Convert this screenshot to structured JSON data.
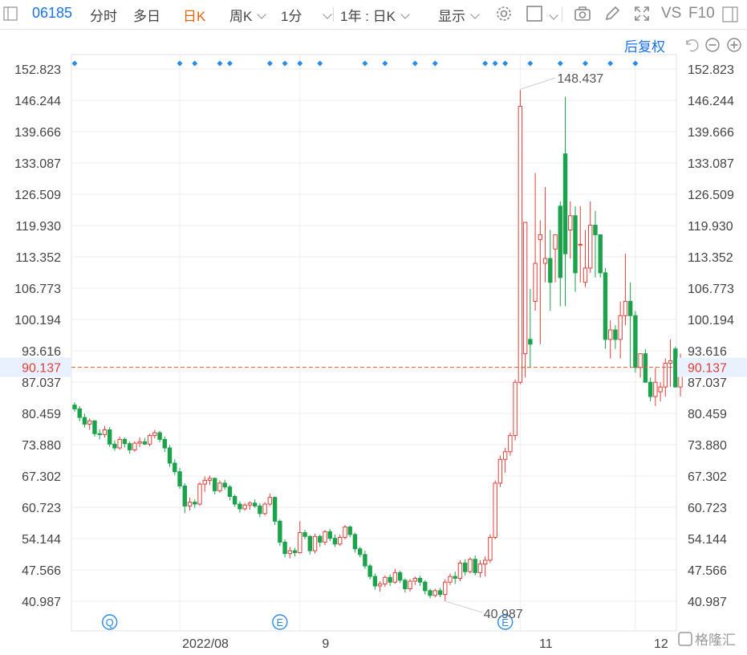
{
  "toolbar": {
    "code": "06185",
    "tabs": [
      "分时",
      "多日",
      "日K",
      "周K",
      "1分",
      "1年 : 日K",
      "显示"
    ],
    "right_labels": {
      "vs": "VS",
      "f10": "F10"
    }
  },
  "subbar": {
    "adjust": "后复权"
  },
  "colors": {
    "up": "#e0403a",
    "down": "#1aa34a",
    "accent": "#1a73e8",
    "grid": "#eeeeee",
    "ref": "#e05a2a"
  },
  "chart_data": {
    "type": "candlestick",
    "y_ticks": [
      "152.823",
      "146.244",
      "139.666",
      "133.087",
      "126.509",
      "119.930",
      "113.352",
      "106.773",
      "100.194",
      "93.616",
      "87.037",
      "80.459",
      "73.880",
      "67.302",
      "60.723",
      "54.144",
      "47.566",
      "40.987"
    ],
    "ylim": [
      40.987,
      152.823
    ],
    "x_ticks": [
      {
        "label": "2022/08",
        "index": 21
      },
      {
        "label": "9",
        "index": 45
      },
      {
        "label": "11",
        "index": 89
      },
      {
        "label": "12",
        "index": 112
      }
    ],
    "current_price": "90.137",
    "max_label": "148.437",
    "min_label": "40.987",
    "event_markers": [
      {
        "label": "Q",
        "index": 7
      },
      {
        "label": "E",
        "index": 41
      },
      {
        "label": "E",
        "index": 86
      }
    ],
    "dot_indices": [
      0,
      21,
      24,
      29,
      31,
      39,
      42,
      45,
      49,
      58,
      62,
      68,
      72,
      82,
      84,
      86,
      91,
      97,
      102,
      107,
      112
    ],
    "candles": [
      [
        82.2,
        82.8,
        80.8,
        81.4
      ],
      [
        81.4,
        82.0,
        78.8,
        79.6
      ],
      [
        79.6,
        80.4,
        77.5,
        78.2
      ],
      [
        78.2,
        79.4,
        77.0,
        78.9
      ],
      [
        78.9,
        79.0,
        75.6,
        76.2
      ],
      [
        76.2,
        77.1,
        75.0,
        76.0
      ],
      [
        76.0,
        77.8,
        75.4,
        77.0
      ],
      [
        77.0,
        77.6,
        73.4,
        74.0
      ],
      [
        74.0,
        74.8,
        72.6,
        73.2
      ],
      [
        73.2,
        75.6,
        72.8,
        75.0
      ],
      [
        75.0,
        75.4,
        73.3,
        74.1
      ],
      [
        74.1,
        74.6,
        72.0,
        72.8
      ],
      [
        72.8,
        74.6,
        72.4,
        74.2
      ],
      [
        74.2,
        75.4,
        73.4,
        74.5
      ],
      [
        74.5,
        75.3,
        73.8,
        74.0
      ],
      [
        74.0,
        76.2,
        73.5,
        75.8
      ],
      [
        75.8,
        77.0,
        75.2,
        76.4
      ],
      [
        76.4,
        76.8,
        74.4,
        75.0
      ],
      [
        75.0,
        75.6,
        72.3,
        73.2
      ],
      [
        73.2,
        73.8,
        69.2,
        70.0
      ],
      [
        70.0,
        70.8,
        67.5,
        68.2
      ],
      [
        68.2,
        69.0,
        64.6,
        65.2
      ],
      [
        65.2,
        65.8,
        59.5,
        61.0
      ],
      [
        61.0,
        62.8,
        60.0,
        61.8
      ],
      [
        61.8,
        62.4,
        60.6,
        61.4
      ],
      [
        61.4,
        66.0,
        61.0,
        65.6
      ],
      [
        65.6,
        67.2,
        64.0,
        66.4
      ],
      [
        66.4,
        67.4,
        65.4,
        66.8
      ],
      [
        66.8,
        67.0,
        63.4,
        64.2
      ],
      [
        64.2,
        66.4,
        63.8,
        65.8
      ],
      [
        65.8,
        66.5,
        64.4,
        65.0
      ],
      [
        65.0,
        65.4,
        62.2,
        63.0
      ],
      [
        63.0,
        63.4,
        60.8,
        61.4
      ],
      [
        61.4,
        62.0,
        59.6,
        60.4
      ],
      [
        60.4,
        61.6,
        60.0,
        61.2
      ],
      [
        61.2,
        62.0,
        60.2,
        61.6
      ],
      [
        61.6,
        62.4,
        60.6,
        61.0
      ],
      [
        61.0,
        61.6,
        58.6,
        59.4
      ],
      [
        59.4,
        61.8,
        59.0,
        61.4
      ],
      [
        61.4,
        63.6,
        61.0,
        62.8
      ],
      [
        62.8,
        63.0,
        57.0,
        57.8
      ],
      [
        57.8,
        58.2,
        52.6,
        53.4
      ],
      [
        53.4,
        54.0,
        50.2,
        51.0
      ],
      [
        51.0,
        52.4,
        50.0,
        51.6
      ],
      [
        51.6,
        52.2,
        50.4,
        51.2
      ],
      [
        51.2,
        57.8,
        51.0,
        55.4
      ],
      [
        55.4,
        56.0,
        54.0,
        54.6
      ],
      [
        54.6,
        54.9,
        50.8,
        51.6
      ],
      [
        51.6,
        55.2,
        51.0,
        54.6
      ],
      [
        54.6,
        55.0,
        52.4,
        53.4
      ],
      [
        53.4,
        56.0,
        52.8,
        55.6
      ],
      [
        55.6,
        56.2,
        53.6,
        54.2
      ],
      [
        54.2,
        55.0,
        52.4,
        53.0
      ],
      [
        53.0,
        55.0,
        52.6,
        54.4
      ],
      [
        54.4,
        57.0,
        54.0,
        56.6
      ],
      [
        56.6,
        56.9,
        54.4,
        55.0
      ],
      [
        55.0,
        55.4,
        51.2,
        52.0
      ],
      [
        52.0,
        52.4,
        50.2,
        50.8
      ],
      [
        50.8,
        51.6,
        47.8,
        48.4
      ],
      [
        48.4,
        48.8,
        45.6,
        46.2
      ],
      [
        46.2,
        46.8,
        43.4,
        44.2
      ],
      [
        44.2,
        45.2,
        43.0,
        44.6
      ],
      [
        44.6,
        46.4,
        44.0,
        46.0
      ],
      [
        46.0,
        46.6,
        44.2,
        45.0
      ],
      [
        45.0,
        47.8,
        44.6,
        47.0
      ],
      [
        47.0,
        47.4,
        44.8,
        45.4
      ],
      [
        45.4,
        45.8,
        42.8,
        43.6
      ],
      [
        43.6,
        45.6,
        43.0,
        45.2
      ],
      [
        45.2,
        46.2,
        44.4,
        45.8
      ],
      [
        45.8,
        46.4,
        44.2,
        45.0
      ],
      [
        45.0,
        45.4,
        42.4,
        43.2
      ],
      [
        43.2,
        43.6,
        41.6,
        42.2
      ],
      [
        42.2,
        43.6,
        41.8,
        43.2
      ],
      [
        43.2,
        43.8,
        41.8,
        42.4
      ],
      [
        42.4,
        45.6,
        41.0,
        45.0
      ],
      [
        45.0,
        46.8,
        44.4,
        46.2
      ],
      [
        46.2,
        47.2,
        44.6,
        45.8
      ],
      [
        45.8,
        49.6,
        45.2,
        49.0
      ],
      [
        49.0,
        49.8,
        46.4,
        47.2
      ],
      [
        47.2,
        50.2,
        46.8,
        49.8
      ],
      [
        49.8,
        50.6,
        46.4,
        47.0
      ],
      [
        47.0,
        49.6,
        46.0,
        48.8
      ],
      [
        48.8,
        50.4,
        46.2,
        49.6
      ],
      [
        49.6,
        55.0,
        49.0,
        54.4
      ],
      [
        54.4,
        66.4,
        54.0,
        65.8
      ],
      [
        65.8,
        71.6,
        65.0,
        70.8
      ],
      [
        70.8,
        73.2,
        68.0,
        72.4
      ],
      [
        72.4,
        76.4,
        71.6,
        75.8
      ],
      [
        75.8,
        87.6,
        74.8,
        87.0
      ],
      [
        87.0,
        148.4,
        86.6,
        145.0
      ],
      [
        93.0,
        119.6,
        88.0,
        120.6
      ],
      [
        96.0,
        106.6,
        90.0,
        95.0
      ],
      [
        104.0,
        131.0,
        102.0,
        112.0
      ],
      [
        117.0,
        121.0,
        95.0,
        118.0
      ],
      [
        112.0,
        128.0,
        108.0,
        113.0
      ],
      [
        113.0,
        119.0,
        102.0,
        108.0
      ],
      [
        115.0,
        118.0,
        108.0,
        118.0
      ],
      [
        124.0,
        125.0,
        103.0,
        109.0
      ],
      [
        135.0,
        147.0,
        103.0,
        114.0
      ],
      [
        119.0,
        125.0,
        113.0,
        122.0
      ],
      [
        122.0,
        124.0,
        106.0,
        110.0
      ],
      [
        116.0,
        124.0,
        108.0,
        116.0
      ],
      [
        108.0,
        119.0,
        107.0,
        111.0
      ],
      [
        111.0,
        125.0,
        110.0,
        120.0
      ],
      [
        120.0,
        123.0,
        109.0,
        118.0
      ],
      [
        118.0,
        118.0,
        109.0,
        110.0
      ],
      [
        110.0,
        111.0,
        94.0,
        96.0
      ],
      [
        96.0,
        100.0,
        92.0,
        98.0
      ],
      [
        98.0,
        99.0,
        94.0,
        96.0
      ],
      [
        96.0,
        104.0,
        92.0,
        101.0
      ],
      [
        101.0,
        114.0,
        99.0,
        104.0
      ],
      [
        104.0,
        108.0,
        90.0,
        101.0
      ],
      [
        101.0,
        102.0,
        89.0,
        90.1
      ],
      [
        90.1,
        93.0,
        88.0,
        93.0
      ],
      [
        93.0,
        94.0,
        87.0,
        87.0
      ],
      [
        87.0,
        88.0,
        83.0,
        84.0
      ],
      [
        84.0,
        90.0,
        82.0,
        87.0
      ],
      [
        85.0,
        87.0,
        83.0,
        86.0
      ],
      [
        86.0,
        92.0,
        84.0,
        91.0
      ],
      [
        91.0,
        96.0,
        86.0,
        91.5
      ],
      [
        94.0,
        94.5,
        87.0,
        86.0
      ],
      [
        86.0,
        93.0,
        84.0,
        90.1
      ]
    ]
  }
}
